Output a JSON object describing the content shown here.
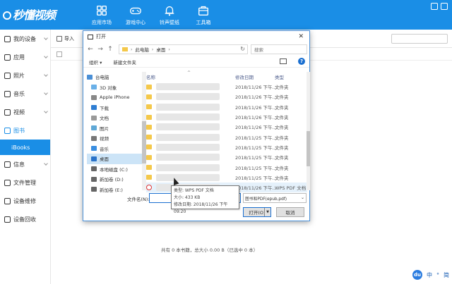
{
  "app": {
    "logo_text": "秒懂视频",
    "nav": [
      {
        "label": "应用市场",
        "icon": "apps-icon"
      },
      {
        "label": "游戏中心",
        "icon": "gamepad-icon"
      },
      {
        "label": "铃声壁纸",
        "icon": "bell-icon"
      },
      {
        "label": "工具箱",
        "icon": "toolbox-icon"
      }
    ],
    "accent": "#1a8ee6"
  },
  "sidebar": {
    "items": [
      {
        "label": "我的设备"
      },
      {
        "label": "应用"
      },
      {
        "label": "照片"
      },
      {
        "label": "音乐"
      },
      {
        "label": "视频"
      },
      {
        "label": "图书"
      }
    ],
    "sub_selected": "iBooks",
    "items_lower": [
      {
        "label": "信息"
      },
      {
        "label": "文件管理"
      },
      {
        "label": "设备维修"
      },
      {
        "label": "设备回收"
      }
    ]
  },
  "main": {
    "import_label": "导入",
    "status_text": "共有 0 本书籍，总大小 0.00 B（已选中 0 本）"
  },
  "tray": {
    "du_label": "du",
    "items": [
      "中",
      "°",
      "简"
    ]
  },
  "dialog": {
    "title": "打开",
    "address": {
      "parts": [
        "此电脑",
        "桌面"
      ]
    },
    "search_placeholder": "搜索",
    "organize_label": "组织 ▾",
    "new_folder_label": "新建文件夹",
    "nav_items": [
      {
        "label": "台电脑"
      },
      {
        "label": "3D 对象"
      },
      {
        "label": "Apple iPhone"
      },
      {
        "label": "下载"
      },
      {
        "label": "文档"
      },
      {
        "label": "图片"
      },
      {
        "label": "视频"
      },
      {
        "label": "音乐"
      },
      {
        "label": "桌面"
      },
      {
        "label": "本地磁盘 (C:)"
      },
      {
        "label": "新加卷 (D:)"
      },
      {
        "label": "新加卷 (E:)"
      }
    ],
    "columns": {
      "name": "名称",
      "date": "修改日期",
      "type": "类型"
    },
    "files": [
      {
        "date": "2018/11/26 下午...",
        "type": "文件夹"
      },
      {
        "date": "2018/11/26 下午...",
        "type": "文件夹"
      },
      {
        "date": "2018/11/26 下午...",
        "type": "文件夹"
      },
      {
        "date": "2018/11/26 下午...",
        "type": "文件夹"
      },
      {
        "date": "2018/11/26 下午...",
        "type": "文件夹"
      },
      {
        "date": "2018/11/25 下午...",
        "type": "文件夹"
      },
      {
        "date": "2018/11/25 下午...",
        "type": "文件夹"
      },
      {
        "date": "2018/11/25 下午...",
        "type": "文件夹"
      },
      {
        "date": "2018/11/25 下午...",
        "type": "文件夹"
      },
      {
        "date": "2018/11/25 下午...",
        "type": "文件夹"
      },
      {
        "date": "2018/11/26 下午...",
        "type": "WPS PDF 文档"
      }
    ],
    "tooltip": {
      "line1": "类型: WPS PDF 文档",
      "line2": "大小: 433 KB",
      "line3": "修改日期: 2018/11/26 下午 09:20"
    },
    "filename_label": "文件名(N):",
    "filename_value": "",
    "filter_value": "图书和PDF(epub,pdf)",
    "open_label": "打开(O)",
    "cancel_label": "取消"
  }
}
